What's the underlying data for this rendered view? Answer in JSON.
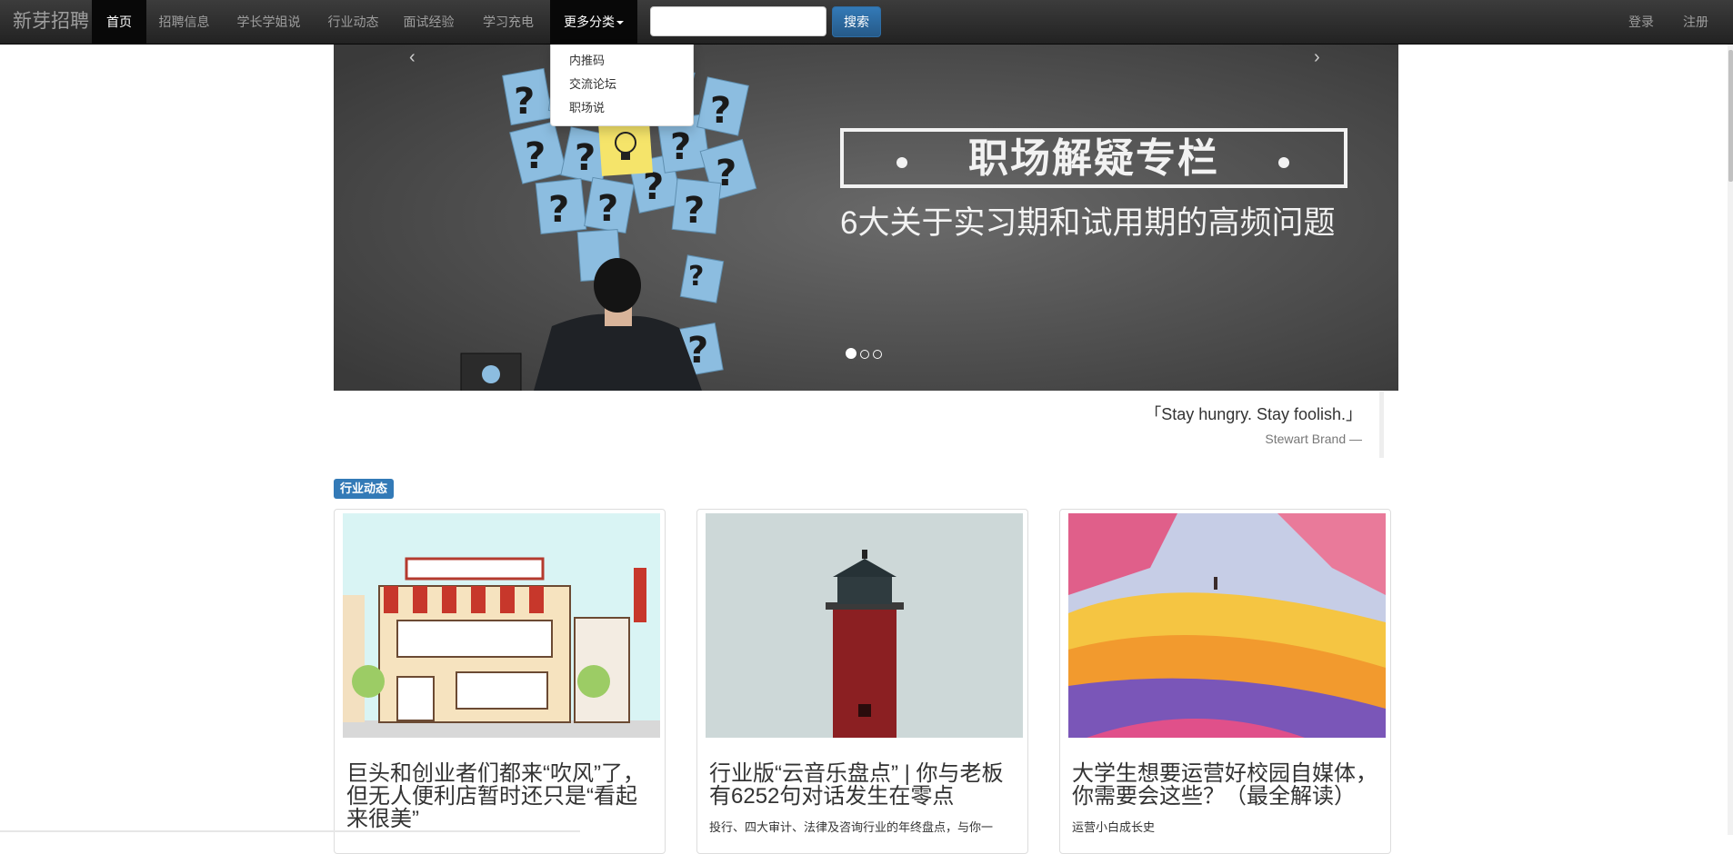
{
  "navbar": {
    "brand": "新芽招聘",
    "items": [
      {
        "label": "首页",
        "active": true
      },
      {
        "label": "招聘信息"
      },
      {
        "label": "学长学姐说"
      },
      {
        "label": "行业动态"
      },
      {
        "label": "面试经验"
      },
      {
        "label": "学习充电"
      }
    ],
    "more": "更多分类",
    "search_value": "",
    "search_button": "搜索",
    "login": "登录",
    "register": "注册"
  },
  "dropdown": {
    "items": [
      "内推码",
      "交流论坛",
      "职场说"
    ]
  },
  "carousel": {
    "prev": "‹",
    "next": "›",
    "title": "职场解疑专栏",
    "subtitle": "6大关于实习期和试用期的高频问题",
    "slide_count": 3,
    "active_index": 0
  },
  "quote": {
    "text": "「Stay hungry. Stay foolish.」",
    "author": "Stewart Brand —"
  },
  "section": {
    "label": "行业动态"
  },
  "cards": [
    {
      "title": "巨头和创业者们都来“吹风”了，但无人便利店暂时还只是“看起来很美”",
      "desc": ""
    },
    {
      "title": "行业版“云音乐盘点” | 你与老板有6252句对话发生在零点",
      "desc": "投行、四大审计、法律及咨询行业的年终盘点，与你一"
    },
    {
      "title": "大学生想要运营好校园自媒体，你需要会这些？（最全解读）",
      "desc": "运营小白成长史"
    }
  ],
  "colors": {
    "primary": "#337ab7",
    "navbar": "#222222"
  }
}
